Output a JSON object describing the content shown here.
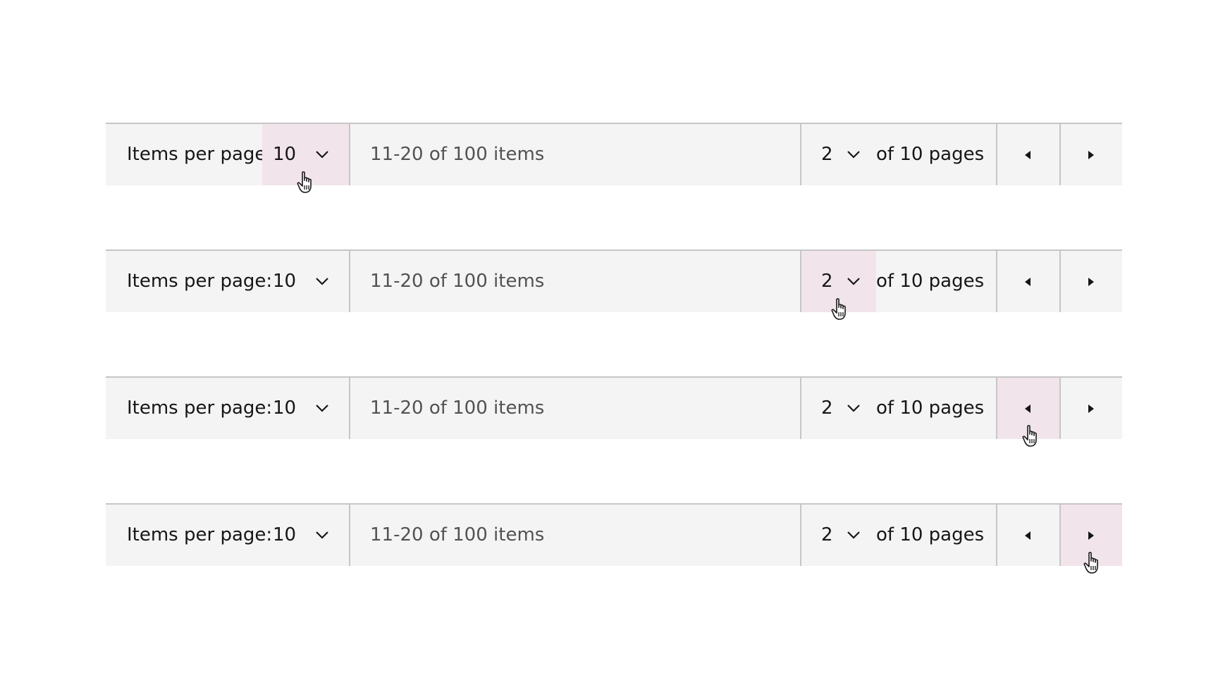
{
  "rows": [
    {
      "items_per_page_label": "Items per page:",
      "items_per_page_value": "10",
      "range_text": "11-20 of 100 items",
      "page_value": "2",
      "of_pages_text": "of 10 pages",
      "hover_target": "items-per-page-select"
    },
    {
      "items_per_page_label": "Items per page:",
      "items_per_page_value": "10",
      "range_text": "11-20 of 100 items",
      "page_value": "2",
      "of_pages_text": "of 10 pages",
      "hover_target": "page-select"
    },
    {
      "items_per_page_label": "Items per page:",
      "items_per_page_value": "10",
      "range_text": "11-20 of 100 items",
      "page_value": "2",
      "of_pages_text": "of 10 pages",
      "hover_target": "previous-page-button"
    },
    {
      "items_per_page_label": "Items per page:",
      "items_per_page_value": "10",
      "range_text": "11-20 of 100 items",
      "page_value": "2",
      "of_pages_text": "of 10 pages",
      "hover_target": "next-page-button"
    }
  ],
  "icons": {
    "dropdown": "chevron-down-icon",
    "previous": "caret-left-icon",
    "next": "caret-right-icon",
    "pointer": "hand-pointer-cursor-icon"
  },
  "colors": {
    "bar_background": "#f4f4f4",
    "divider": "#c6c6c6",
    "hover_background": "#f2e4eb",
    "primary_text": "#161616",
    "secondary_text": "#525252"
  }
}
